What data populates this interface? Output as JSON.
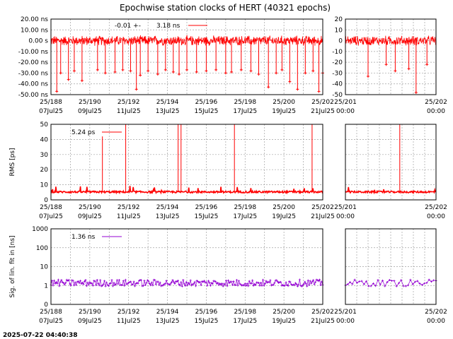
{
  "title": "Epochwise station clocks of HERT (40321 epochs)",
  "timestamp": "2025-07-22 04:40:38",
  "colors": {
    "clock": "#ff0000",
    "rms": "#ff0000",
    "sig": "#9400d3",
    "grid": "#a0a0a0"
  },
  "x_ticks_main": [
    {
      "top": "25/188",
      "bottom": "07Jul25"
    },
    {
      "top": "25/190",
      "bottom": "09Jul25"
    },
    {
      "top": "25/192",
      "bottom": "11Jul25"
    },
    {
      "top": "25/194",
      "bottom": "13Jul25"
    },
    {
      "top": "25/196",
      "bottom": "15Jul25"
    },
    {
      "top": "25/198",
      "bottom": "17Jul25"
    },
    {
      "top": "25/200",
      "bottom": "19Jul25"
    },
    {
      "top": "25/202",
      "bottom": "21Jul25"
    }
  ],
  "x_ticks_zoom": [
    {
      "top": "25/201",
      "bottom": "00:00"
    },
    {
      "top": "25/202",
      "bottom": "00:00"
    }
  ],
  "chart_data": [
    {
      "type": "line",
      "panel": "clock",
      "xlabel": "",
      "ylabel": "",
      "ylim": [
        -50,
        20
      ],
      "y_ticks": [
        {
          "value": 20,
          "label": "20.00 ns",
          "zoom_label": "20"
        },
        {
          "value": 10,
          "label": "10.00 ns",
          "zoom_label": "10"
        },
        {
          "value": 0,
          "label": "0.00  s",
          "zoom_label": "0"
        },
        {
          "value": -10,
          "label": "-10.00 ns",
          "zoom_label": "-10"
        },
        {
          "value": -20,
          "label": "-20.00 ns",
          "zoom_label": "-20"
        },
        {
          "value": -30,
          "label": "-30.00 ns",
          "zoom_label": "-30"
        },
        {
          "value": -40,
          "label": "-40.00 ns",
          "zoom_label": "-40"
        },
        {
          "value": -50,
          "label": "-50.00 ns",
          "zoom_label": "-50"
        }
      ],
      "legend": {
        "mean": "-0.01 +-",
        "sigma": "3.18 ns",
        "position": "top-left"
      },
      "mean": -0.01,
      "sigma": 3.18,
      "band_center": 0,
      "band_halfwidth": 4,
      "outliers_main": [
        [
          188.3,
          -47
        ],
        [
          188.5,
          -30
        ],
        [
          188.9,
          -36
        ],
        [
          189.2,
          -28
        ],
        [
          189.6,
          -37
        ],
        [
          190.4,
          -27
        ],
        [
          190.8,
          -30
        ],
        [
          191.3,
          -29
        ],
        [
          191.7,
          -27
        ],
        [
          192.1,
          -28
        ],
        [
          192.4,
          -45
        ],
        [
          192.6,
          -32
        ],
        [
          193.0,
          -28
        ],
        [
          193.5,
          -31
        ],
        [
          193.9,
          -27
        ],
        [
          194.3,
          -29
        ],
        [
          194.6,
          -31
        ],
        [
          195.0,
          -27
        ],
        [
          195.5,
          -29
        ],
        [
          196.0,
          -28
        ],
        [
          196.5,
          -27
        ],
        [
          197.0,
          -30
        ],
        [
          197.3,
          -29
        ],
        [
          197.8,
          -27
        ],
        [
          198.3,
          -28
        ],
        [
          198.7,
          -31
        ],
        [
          199.2,
          -43
        ],
        [
          199.6,
          -30
        ],
        [
          199.9,
          -27
        ],
        [
          200.3,
          -38
        ],
        [
          200.7,
          -45
        ],
        [
          201.1,
          -30
        ],
        [
          201.5,
          -28
        ],
        [
          201.8,
          -47
        ],
        [
          202.0,
          -30
        ]
      ],
      "outliers_zoom": [
        [
          201.25,
          -33
        ],
        [
          201.45,
          -22
        ],
        [
          201.55,
          -28
        ],
        [
          201.7,
          -26
        ],
        [
          201.78,
          -48
        ],
        [
          201.9,
          -22
        ]
      ]
    },
    {
      "type": "line",
      "panel": "rms",
      "xlabel": "",
      "ylabel": "RMS [ps]",
      "ylim": [
        0,
        50
      ],
      "y_ticks": [
        {
          "value": 50,
          "label": "50"
        },
        {
          "value": 40,
          "label": "40"
        },
        {
          "value": 30,
          "label": "30"
        },
        {
          "value": 20,
          "label": "20"
        },
        {
          "value": 10,
          "label": "10"
        },
        {
          "value": 0,
          "label": "0"
        }
      ],
      "legend": {
        "text": "5.24 ps",
        "position": "top-left"
      },
      "baseline": 5.24,
      "spikes_main": [
        [
          190.65,
          42
        ],
        [
          191.85,
          50
        ],
        [
          194.55,
          50
        ],
        [
          194.7,
          50
        ],
        [
          197.45,
          50
        ],
        [
          201.45,
          50
        ]
      ],
      "spikes_zoom": [
        [
          201.6,
          50
        ]
      ]
    },
    {
      "type": "line",
      "panel": "sig",
      "xlabel": "",
      "ylabel": "Sig. of lin. fit in [ns]",
      "log_scale": true,
      "ylim": [
        0.1,
        1000
      ],
      "y_ticks": [
        {
          "value": 1000,
          "label": "1000"
        },
        {
          "value": 100,
          "label": "100"
        },
        {
          "value": 10,
          "label": "10"
        },
        {
          "value": 1,
          "label": "1"
        },
        {
          "value": 0.1,
          "label": "0"
        }
      ],
      "legend": {
        "text": "1.36 ns",
        "position": "top-left"
      },
      "baseline": 1.36
    }
  ]
}
